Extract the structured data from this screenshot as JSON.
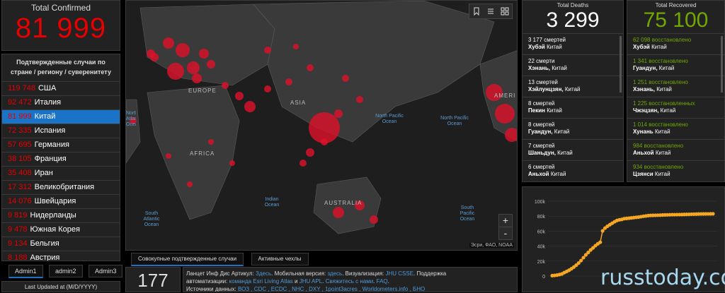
{
  "confirmed": {
    "label": "Total Confirmed",
    "value": "81 999"
  },
  "country_list": {
    "header": "Подтвержденные случаи по стране / региону / суверенитету",
    "rows": [
      {
        "value": "119 748",
        "name": "США"
      },
      {
        "value": "92 472",
        "name": "Италия"
      },
      {
        "value": "81 999",
        "name": "Китай"
      },
      {
        "value": "72 335",
        "name": "Испания"
      },
      {
        "value": "57 695",
        "name": "Германия"
      },
      {
        "value": "38 105",
        "name": "Франция"
      },
      {
        "value": "35 408",
        "name": "Иран"
      },
      {
        "value": "17 312",
        "name": "Великобритания"
      },
      {
        "value": "14 076",
        "name": "Швейцария"
      },
      {
        "value": "9 819",
        "name": "Нидерланды"
      },
      {
        "value": "9 478",
        "name": "Южная Корея"
      },
      {
        "value": "9 134",
        "name": "Бельгия"
      },
      {
        "value": "8 188",
        "name": "Австрия"
      }
    ]
  },
  "admin_tabs": [
    "Admin1",
    "admin2",
    "Admin3"
  ],
  "last_updated": "Last Updated at (M/D/YYYY)",
  "map": {
    "continents": [
      "EUROPE",
      "ASIA",
      "AFRICA",
      "AUSTRALIA",
      "AMERI"
    ],
    "oceans": [
      "North Pacific Ocean",
      "North Pacific Ocean",
      "Indian Ocean",
      "South Atlantic Ocean",
      "South Pacific Ocean",
      "North Atlantic Ocean"
    ],
    "attribution": "Эсри, ФАО, NOAA",
    "zoom_in": "+",
    "zoom_out": "-"
  },
  "map_tabs": [
    "Совокупные подтвержденные случаи",
    "Активные чехлы"
  ],
  "country_count": "177",
  "info": {
    "line1_a": "Ланцет Инф Дис Артикул: ",
    "line1_b": "Здесь",
    "line1_c": ". Мобильная версия: ",
    "line1_d": "здесь",
    "line1_e": ". Визуализация: ",
    "line1_f": "JHU CSSE",
    "line1_g": ". Поддержка",
    "line2_a": "автоматизации: ",
    "line2_b": "команда Esri Living Atlas",
    "line2_c": " и ",
    "line2_d": "JHU APL",
    "line2_e": ". ",
    "line2_f": "Свяжитесь с нами",
    "line2_g": ". ",
    "line2_h": "FAQ",
    "line2_i": ".",
    "line3_a": "Источники данных: ",
    "line3_b": "ВОЗ , CDC , ECDC , NHC , DXY , 1point3acres , Worldometers.info , БНО"
  },
  "deaths": {
    "label": "Total Deaths",
    "value": "3 299",
    "rows": [
      {
        "count": "3 177",
        "unit": "смертей",
        "region": "Хубэй",
        "country": "Китай"
      },
      {
        "count": "22",
        "unit": "смерти",
        "region": "Хэнань,",
        "country": "Китай"
      },
      {
        "count": "13",
        "unit": "смертей",
        "region": "Хэйлунцзян,",
        "country": "Китай"
      },
      {
        "count": "8",
        "unit": "смертей",
        "region": "Пекин",
        "country": "Китай"
      },
      {
        "count": "8",
        "unit": "смертей",
        "region": "Гуандун,",
        "country": "Китай"
      },
      {
        "count": "7",
        "unit": "смертей",
        "region": "Шаньдун,",
        "country": "Китай"
      },
      {
        "count": "6",
        "unit": "смертей",
        "region": "Аньхой",
        "country": "Китай"
      }
    ]
  },
  "recovered": {
    "label": "Total Recovered",
    "value": "75 100",
    "rows": [
      {
        "count": "62 098",
        "unit": "восстановлено",
        "region": "Хубэй",
        "country": "Китай"
      },
      {
        "count": "1 341",
        "unit": "восстановлено",
        "region": "Гуандун,",
        "country": "Китай"
      },
      {
        "count": "1 251",
        "unit": "восстановлено",
        "region": "Хэнань,",
        "country": "Китай"
      },
      {
        "count": "1 225",
        "unit": "восстановленных",
        "region": "Чжэцзян,",
        "country": "Китай"
      },
      {
        "count": "1 014",
        "unit": "восстановлено",
        "region": "Хунань",
        "country": "Китай"
      },
      {
        "count": "984",
        "unit": "восстановлено",
        "region": "Аньхой",
        "country": "Китай"
      },
      {
        "count": "934",
        "unit": "восстановлено",
        "region": "Цзянси",
        "country": "Китай"
      }
    ]
  },
  "watermark": "russtoday.com",
  "colors": {
    "confirmed": "#e60000",
    "recovered": "#70a800",
    "selected": "#1a73c7",
    "chart_line": "#f5a623"
  },
  "chart_data": {
    "type": "line",
    "ytick_labels": [
      "100k",
      "80k",
      "60k",
      "40k",
      "20k",
      "0"
    ],
    "ylim": [
      0,
      100000
    ],
    "series": [
      {
        "values": [
          580,
          850,
          1300,
          2000,
          2800,
          4600,
          6100,
          7800,
          9800,
          12000,
          14500,
          17400,
          20700,
          24600,
          28300,
          31500,
          34900,
          37600,
          40600,
          43100,
          45200,
          60400,
          64100,
          66500,
          68600,
          70600,
          72600,
          74300,
          75200,
          75700,
          76700,
          77000,
          77300,
          77700,
          78100,
          78500,
          78800,
          79300,
          79900,
          80300,
          80800,
          81000,
          81100,
          81200,
          81300,
          81400,
          81600,
          81700,
          81800,
          81900,
          81999,
          82000,
          82100,
          82150,
          82200,
          82300,
          82400,
          82500,
          82600,
          82700,
          82800,
          82900,
          82950,
          83000,
          83050,
          83100,
          83150,
          83200
        ]
      }
    ]
  }
}
